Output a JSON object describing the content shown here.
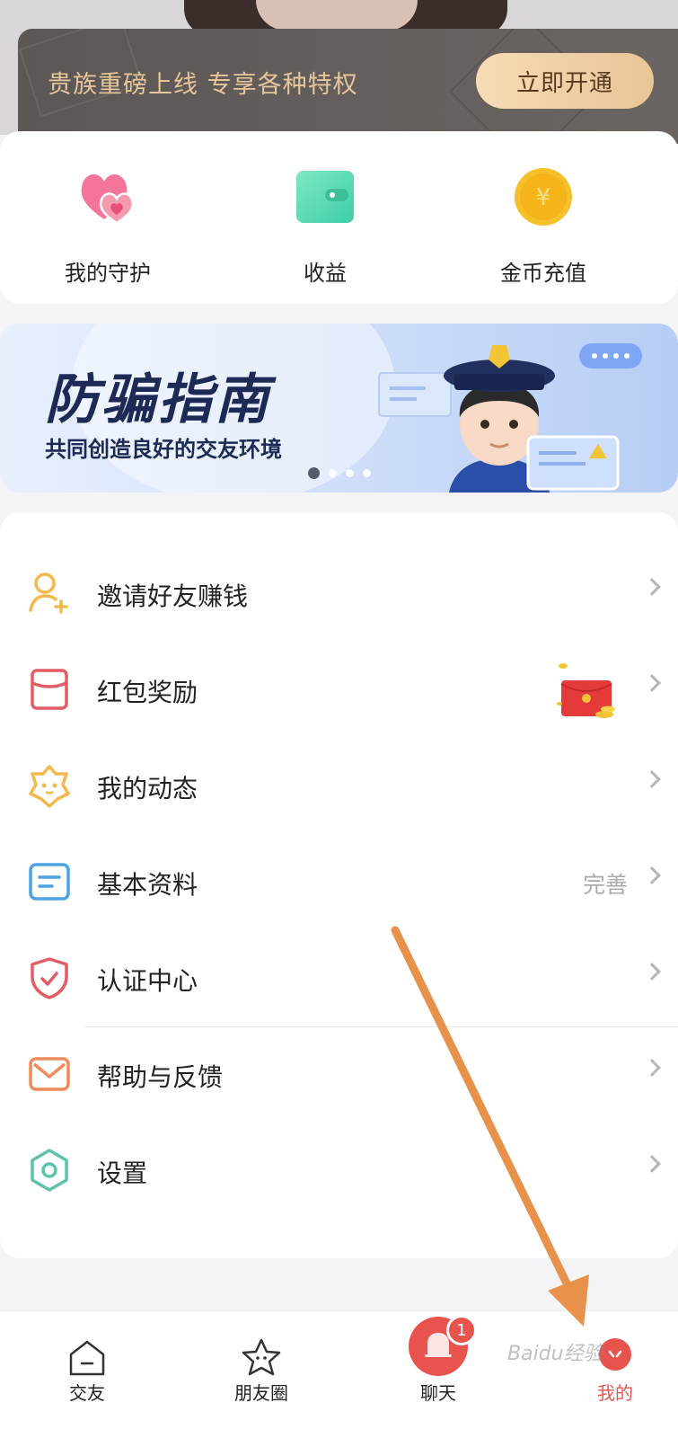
{
  "vip_banner": {
    "text": "贵族重磅上线 专享各种特权",
    "button": "立即开通"
  },
  "quick_actions": [
    {
      "label": "我的守护",
      "icon": "hearts-icon"
    },
    {
      "label": "收益",
      "icon": "wallet-icon"
    },
    {
      "label": "金币充值",
      "icon": "gold-coin-icon"
    }
  ],
  "fraud_banner": {
    "title": "防骗指南",
    "subtitle": "共同创造良好的交友环境",
    "page_count": 4,
    "active_page": 1
  },
  "menu": {
    "items": [
      {
        "label": "邀请好友赚钱",
        "icon": "invite-friend-icon"
      },
      {
        "label": "红包奖励",
        "icon": "red-packet-icon"
      },
      {
        "label": "我的动态",
        "icon": "moments-icon"
      },
      {
        "label": "基本资料",
        "icon": "profile-card-icon",
        "status": "完善"
      },
      {
        "label": "认证中心",
        "icon": "shield-icon"
      },
      {
        "label": "帮助与反馈",
        "icon": "mail-icon"
      },
      {
        "label": "设置",
        "icon": "settings-hexagon-icon"
      }
    ]
  },
  "bottom_nav": {
    "items": [
      {
        "label": "交友",
        "icon": "home-icon"
      },
      {
        "label": "朋友圈",
        "icon": "star-face-icon"
      },
      {
        "label": "聊天",
        "icon": "bell-icon",
        "badge": "1"
      },
      {
        "label": "我的",
        "icon": "profile-icon"
      }
    ]
  },
  "watermark": "Baidu经验",
  "colors": {
    "vip_gold": "#e6c79c",
    "accent_red": "#e8534e",
    "arrow_orange": "#e8914a",
    "fraud_title": "#1c2a55"
  }
}
